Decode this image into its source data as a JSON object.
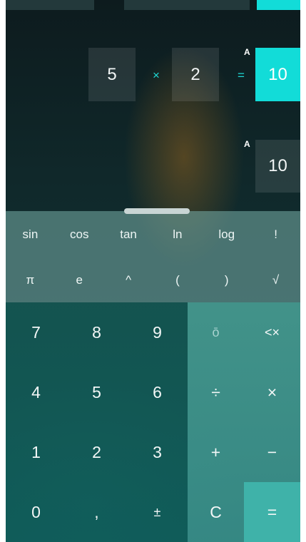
{
  "history": {
    "row1": {
      "operand1": "5",
      "operator": "×",
      "operand2": "2",
      "equals": "=",
      "answer_tag": "A",
      "result": "10"
    },
    "row2": {
      "answer_tag": "A",
      "result": "10"
    }
  },
  "functions": {
    "row1": [
      "sin",
      "cos",
      "tan",
      "ln",
      "log",
      "!"
    ],
    "row2": [
      "π",
      "e",
      "^",
      "(",
      ")",
      "√"
    ]
  },
  "keypad": {
    "digits": [
      "7",
      "8",
      "9",
      "4",
      "5",
      "6",
      "1",
      "2",
      "3",
      "0",
      ",",
      "±"
    ],
    "ops": {
      "memory": "ō",
      "backspace": "<×",
      "divide": "÷",
      "multiply": "×",
      "plus": "+",
      "minus": "−",
      "clear": "C",
      "equals": "="
    }
  },
  "colors": {
    "accent": "#12dcd8",
    "equals_key": "#3fb2a9"
  }
}
